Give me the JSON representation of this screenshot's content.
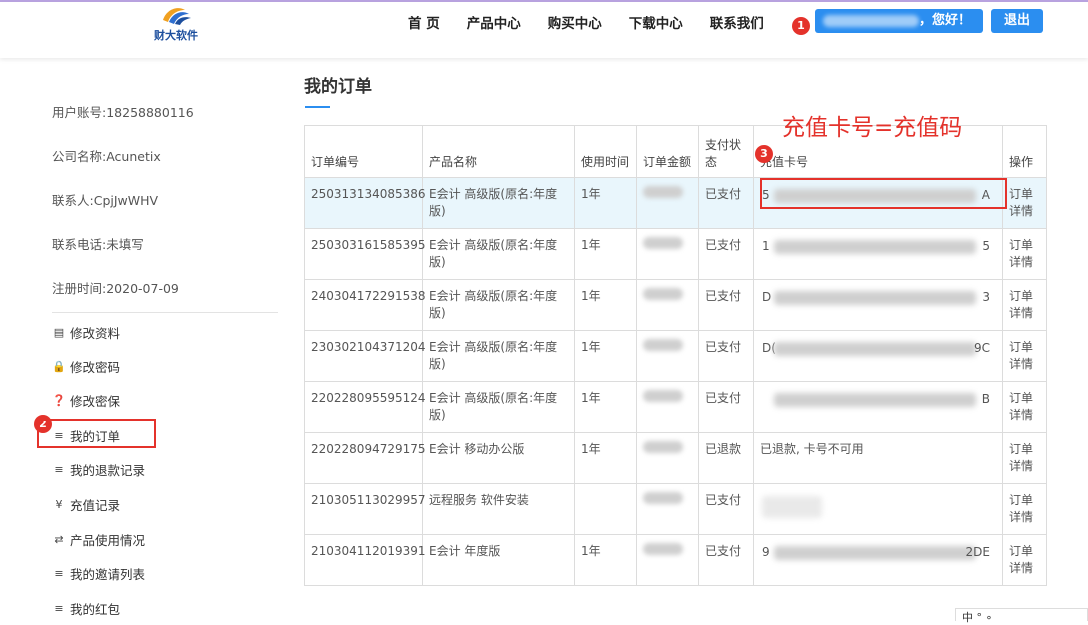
{
  "header": {
    "logo_text": "财大软件",
    "nav": [
      "首 页",
      "产品中心",
      "购买中心",
      "下载中心",
      "联系我们"
    ],
    "greeting_suffix": "，您好！",
    "logout_label": "退出"
  },
  "annotations": {
    "badge1": "1",
    "badge2": "2",
    "badge3": "3",
    "note": "充值卡号=充值码"
  },
  "sidebar": {
    "account": "用户账号:18258880116",
    "company": "公司名称:Acunetix",
    "contact": "联系人:CpjJwWHV",
    "phone": "联系电话:未填写",
    "register": "注册时间:2020-07-09",
    "menu": [
      {
        "icon": "card-icon",
        "glyph": "▤",
        "label": "修改资料"
      },
      {
        "icon": "lock-icon",
        "glyph": "🔒",
        "label": "修改密码"
      },
      {
        "icon": "question-icon",
        "glyph": "❓",
        "label": "修改密保"
      },
      {
        "icon": "list-icon",
        "glyph": "≡",
        "label": "我的订单"
      },
      {
        "icon": "list-icon",
        "glyph": "≡",
        "label": "我的退款记录"
      },
      {
        "icon": "yen-icon",
        "glyph": "¥",
        "label": "充值记录"
      },
      {
        "icon": "exchange-icon",
        "glyph": "⇄",
        "label": "产品使用情况"
      },
      {
        "icon": "list-icon",
        "glyph": "≡",
        "label": "我的邀请列表"
      },
      {
        "icon": "list-icon",
        "glyph": "≡",
        "label": "我的红包"
      }
    ]
  },
  "main": {
    "title": "我的订单",
    "columns": [
      "订单编号",
      "产品名称",
      "使用时间",
      "订单金额",
      "支付状态",
      "充值卡号",
      "操作"
    ],
    "rows": [
      {
        "order": "250313134085386",
        "product": "E会计 高级版(原名:年度版)",
        "period": "1年",
        "status": "已支付",
        "card_pre": "5",
        "card_suf": "A",
        "op": "订单详情"
      },
      {
        "order": "250303161585395",
        "product": "E会计 高级版(原名:年度版)",
        "period": "1年",
        "status": "已支付",
        "card_pre": "1",
        "card_suf": "5",
        "op": "订单详情"
      },
      {
        "order": "240304172291538",
        "product": "E会计 高级版(原名:年度版)",
        "period": "1年",
        "status": "已支付",
        "card_pre": "D",
        "card_suf": "3",
        "op": "订单详情"
      },
      {
        "order": "230302104371204",
        "product": "E会计 高级版(原名:年度版)",
        "period": "1年",
        "status": "已支付",
        "card_pre": "D(",
        "card_suf": "9C",
        "op": "订单详情"
      },
      {
        "order": "220228095595124",
        "product": "E会计 高级版(原名:年度版)",
        "period": "1年",
        "status": "已支付",
        "card_pre": "",
        "card_suf": "B",
        "op": "订单详情"
      },
      {
        "order": "220228094729175",
        "product": "E会计 移动办公版",
        "period": "1年",
        "status": "已退款",
        "card_text": "已退款, 卡号不可用",
        "op": "订单详情"
      },
      {
        "order": "210305113029957",
        "product": "远程服务 软件安装",
        "period": "",
        "status": "已支付",
        "card_pre": "",
        "card_suf": "",
        "op": "订单详情"
      },
      {
        "order": "210304112019391",
        "product": "E会计 年度版",
        "period": "1年",
        "status": "已支付",
        "card_pre": "9",
        "card_suf": "2DE",
        "op": "订单详情"
      }
    ]
  },
  "corner_text": "中 ° ∘"
}
